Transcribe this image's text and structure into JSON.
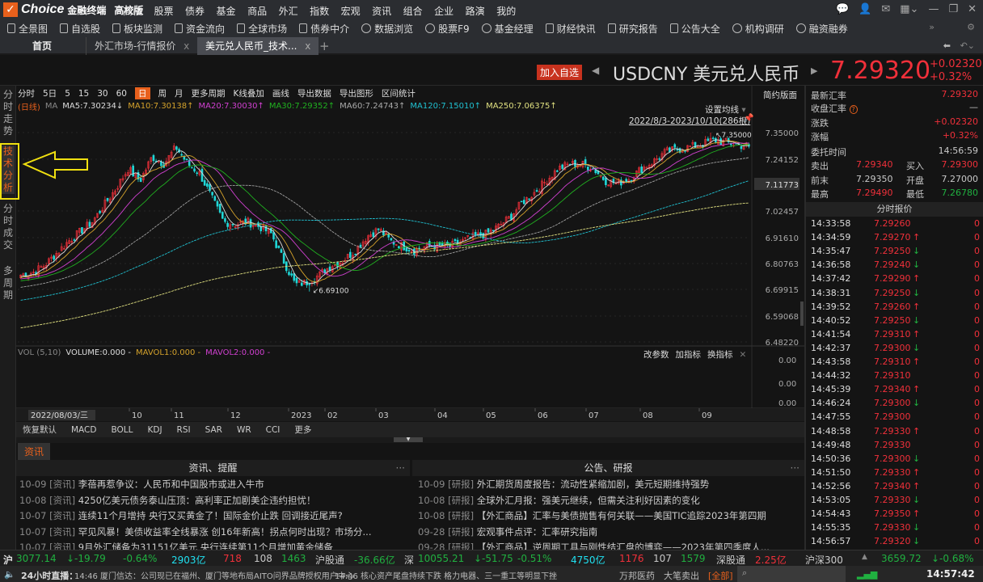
{
  "app": {
    "brand": "Choice",
    "brand_sub": "金融终端",
    "edition": "高校版"
  },
  "menu": [
    "高校",
    "股票",
    "债券",
    "基金",
    "商品",
    "外汇",
    "指数",
    "宏观",
    "资讯",
    "组合",
    "企业",
    "路演",
    "我的"
  ],
  "toolbar": [
    "全景图",
    "自选股",
    "板块监测",
    "资金流向",
    "全球市场",
    "债券中介",
    "数据浏览",
    "股票F9",
    "基金经理",
    "财经快讯",
    "研究报告",
    "公告大全",
    "机构调研",
    "融资融券"
  ],
  "tabs": {
    "home": "首页",
    "tab1": "外汇市场-行情报价",
    "tab2": "美元兑人民币_技术...",
    "close": "x",
    "add": "+"
  },
  "quote": {
    "add_fav": "加入自选",
    "symbol": "USDCNY",
    "name": "美元兑人民币",
    "last": "7.29320",
    "change": "+0.02320",
    "pct": "+0.32%"
  },
  "leftnav": [
    "分时走势",
    "技术分析",
    "分时成交",
    "多周期"
  ],
  "chartbar": {
    "periods": [
      "分时",
      "5日",
      "5",
      "15",
      "30",
      "60",
      "日",
      "周",
      "月"
    ],
    "more": "更多周期",
    "overlay": "K线叠加",
    "draw": "画线",
    "export_data": "导出数据",
    "export_img": "导出图形",
    "range_stats": "区间统计",
    "simple": "简约版面",
    "set_ma": "设置均线",
    "range": "2022/8/3-2023/10/10(286根)"
  },
  "ma": {
    "tag": "(日线)",
    "label": "MA",
    "ma5": "MA5:7.30234↓",
    "ma10": "MA10:7.30138↑",
    "ma20": "MA20:7.30030↑",
    "ma30": "MA30:7.29352↑",
    "ma60": "MA60:7.24743↑",
    "ma120": "MA120:7.15010↑",
    "ma250": "MA250:7.06375↑"
  },
  "vol": {
    "title": "VOL (5,10)",
    "volume": "VOLUME:0.000 -",
    "mavol1": "MAVOL1:0.000 -",
    "mavol2": "MAVOL2:0.000 -",
    "edit": "改参数",
    "add": "加指标",
    "switch": "换指标",
    "axis": [
      "0.00",
      "0.00",
      "0.00"
    ]
  },
  "xaxis": {
    "cursor_date": "2022/08/03/三",
    "labels": [
      "10",
      "11",
      "12",
      "2023",
      "02",
      "03",
      "04",
      "05",
      "06",
      "07",
      "08",
      "09"
    ]
  },
  "indicators": [
    "恢复默认",
    "MACD",
    "BOLL",
    "KDJ",
    "RSI",
    "SAR",
    "WR",
    "CCI",
    "更多"
  ],
  "chart_data": {
    "type": "candlestick",
    "yaxis_labels": [
      "7.35000",
      "7.24152",
      "7.11773",
      "7.02457",
      "6.91610",
      "6.80763",
      "6.69915",
      "6.59068",
      "6.48220"
    ],
    "ylim": [
      6.4822,
      7.35
    ],
    "high_label": "7.35000",
    "low_label": "6.69100",
    "weekly_closes": [
      6.76,
      6.77,
      6.8,
      6.85,
      6.9,
      6.94,
      6.98,
      7.05,
      7.12,
      7.2,
      7.15,
      7.25,
      7.22,
      7.29,
      7.22,
      7.18,
      7.08,
      6.98,
      6.97,
      6.98,
      6.96,
      6.93,
      6.82,
      6.72,
      6.73,
      6.76,
      6.8,
      6.82,
      6.86,
      6.92,
      6.95,
      6.9,
      6.88,
      6.86,
      6.88,
      6.88,
      6.88,
      6.9,
      6.92,
      6.93,
      6.96,
      7.0,
      7.06,
      7.1,
      7.15,
      7.2,
      7.22,
      7.22,
      7.2,
      7.15,
      7.14,
      7.16,
      7.2,
      7.23,
      7.27,
      7.28,
      7.29,
      7.3,
      7.32,
      7.31,
      7.3,
      7.29
    ],
    "bars": 286,
    "colors": {
      "up": "#f0303a",
      "down": "#20d8d8",
      "ma5": "#dddddd",
      "ma10": "#d4a22b",
      "ma20": "#d040d0",
      "ma30": "#20b020",
      "ma60": "#a0a0a0",
      "ma120": "#20c0d0",
      "ma250": "#e0e080"
    }
  },
  "stats": {
    "latest_l": "最新汇率",
    "latest": "7.29320",
    "close_l": "收盘汇率",
    "close_help": "?",
    "close": "—",
    "chg_l": "涨跌",
    "chg": "+0.02320",
    "pct_l": "涨幅",
    "pct": "+0.32%",
    "time_l": "委托时间",
    "time": "14:56:59",
    "ask_l": "卖出",
    "ask": "7.29340",
    "bid_l": "买入",
    "bid": "7.29300",
    "prev_l": "前末",
    "prev": "7.29350",
    "open_l": "开盘",
    "open": "7.27000",
    "high_l": "最高",
    "high": "7.29490",
    "low_l": "最低",
    "low": "7.26780"
  },
  "ticks_title": "分时报价",
  "ticks": [
    [
      "14:33:58",
      "7.29260",
      "",
      "0"
    ],
    [
      "14:34:59",
      "7.29270",
      "↑",
      "0"
    ],
    [
      "14:35:47",
      "7.29250",
      "↓",
      "0"
    ],
    [
      "14:36:58",
      "7.29240",
      "↓",
      "0"
    ],
    [
      "14:37:42",
      "7.29290",
      "↑",
      "0"
    ],
    [
      "14:38:31",
      "7.29250",
      "↓",
      "0"
    ],
    [
      "14:39:52",
      "7.29260",
      "↑",
      "0"
    ],
    [
      "14:40:52",
      "7.29250",
      "↓",
      "0"
    ],
    [
      "14:41:54",
      "7.29310",
      "↑",
      "0"
    ],
    [
      "14:42:37",
      "7.29300",
      "↓",
      "0"
    ],
    [
      "14:43:58",
      "7.29310",
      "↑",
      "0"
    ],
    [
      "14:44:32",
      "7.29310",
      "",
      "0"
    ],
    [
      "14:45:39",
      "7.29340",
      "↑",
      "0"
    ],
    [
      "14:46:24",
      "7.29300",
      "↓",
      "0"
    ],
    [
      "14:47:55",
      "7.29300",
      "",
      "0"
    ],
    [
      "14:48:58",
      "7.29330",
      "↑",
      "0"
    ],
    [
      "14:49:48",
      "7.29330",
      "",
      "0"
    ],
    [
      "14:50:36",
      "7.29300",
      "↓",
      "0"
    ],
    [
      "14:51:50",
      "7.29330",
      "↑",
      "0"
    ],
    [
      "14:52:56",
      "7.29340",
      "↑",
      "0"
    ],
    [
      "14:53:05",
      "7.29330",
      "↓",
      "0"
    ],
    [
      "14:54:43",
      "7.29350",
      "↑",
      "0"
    ],
    [
      "14:55:35",
      "7.29330",
      "↓",
      "0"
    ],
    [
      "14:56:57",
      "7.29320",
      "↓",
      "0"
    ]
  ],
  "news": {
    "tab": "资讯",
    "left_title": "资讯、提醒",
    "right_title": "公告、研报",
    "more": "···",
    "left": [
      [
        "10-09",
        "[资讯]",
        "李蓓再惹争议：人民币和中国股市或进入牛市"
      ],
      [
        "10-08",
        "[资讯]",
        "4250亿美元债务泰山压顶：高利率正加剧美企违约担忧！"
      ],
      [
        "10-07",
        "[资讯]",
        "连续11个月增持 央行又买黄金了！国际金价止跌 回调接近尾声?"
      ],
      [
        "10-07",
        "[资讯]",
        "罕见风暴！美债收益率全线暴涨  创16年新高！拐点何时出现？市场分..."
      ],
      [
        "10-07",
        "[资讯]",
        "9月外汇储备为31151亿美元 央行连续第11个月增加黄金储备"
      ]
    ],
    "right": [
      [
        "10-09",
        "[研报]",
        "外汇期货周度报告：流动性紧缩加剧，美元短期维持强势"
      ],
      [
        "10-08",
        "[研报]",
        "全球外汇月报：强美元继续，但需关注利好因素的变化"
      ],
      [
        "10-08",
        "[研报]",
        "【外汇商品】汇率与美债抛售有何关联——美国TIC追踪2023年第四期"
      ],
      [
        "09-28",
        "[研报]",
        "宏观事件点评：汇率研究指南"
      ],
      [
        "09-28",
        "[研报]",
        "【外汇商品】逆周期工具与刚性结汇盘的博弈——2023年第四季度人..."
      ]
    ]
  },
  "status1": {
    "sh": "沪",
    "sh_v": "3077.14",
    "sh_c": "↓-19.79",
    "sh_p": "-0.64%",
    "sh_amt": "2903亿",
    "sh_up": "718",
    "sh_eq": "108",
    "sh_dn": "1463",
    "hgt": "沪股通",
    "hgt_v": "-36.66亿",
    "sz": "深",
    "sz_v": "10055.21",
    "sz_c": "↓-51.75",
    "sz_p": "-0.51%",
    "sz_amt": "4750亿",
    "sz_up": "1176",
    "sz_eq": "107",
    "sz_dn": "1579",
    "sgt": "深股通",
    "sgt_v": "2.25亿",
    "hs300": "沪深300",
    "hs_v": "3659.72",
    "hs_p": "↓-0.68%"
  },
  "status2": {
    "live": "24小时直播：",
    "n1": "14:46 厦门信达：公司现已在福州、厦门等地布局AITO问界品牌授权用户中心",
    "n2": "14:46 核心资产尾盘持续下跌 格力电器、三一重工等明显下挫",
    "s1": "万邦医药",
    "s2": "大笔卖出",
    "all": "[全部]",
    "clock": "14:57:42"
  }
}
